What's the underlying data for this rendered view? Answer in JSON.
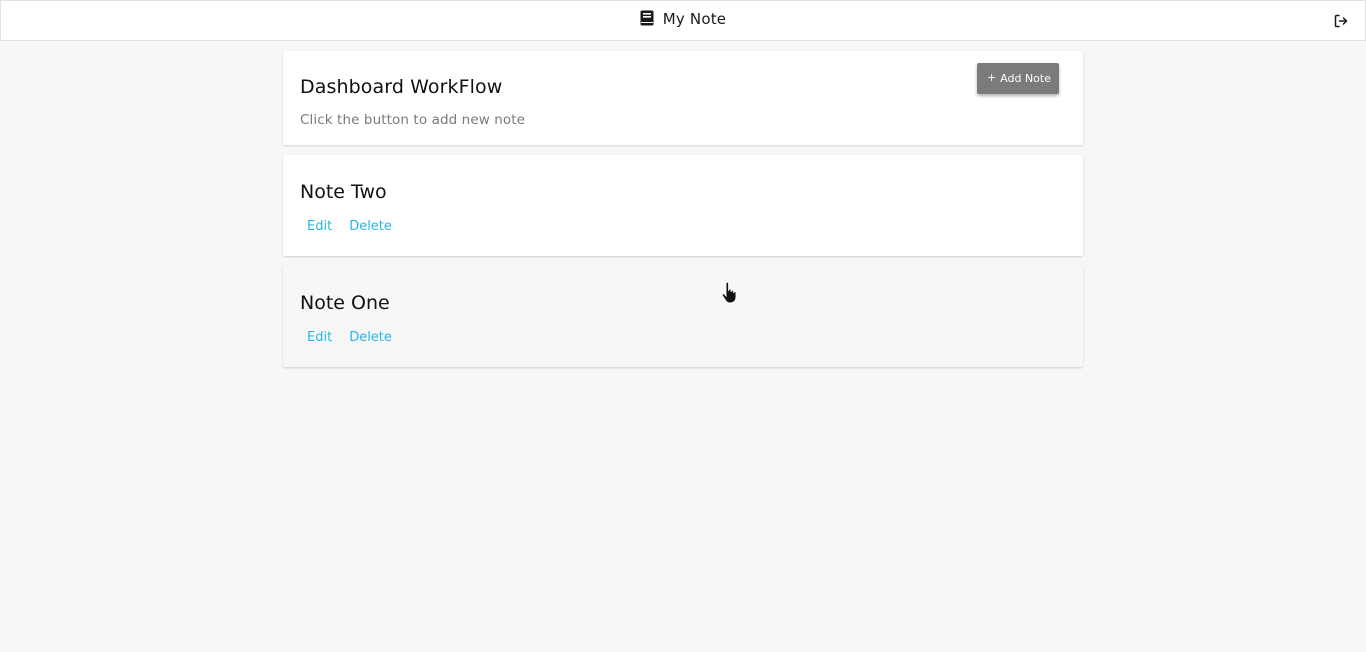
{
  "header": {
    "title": "My Note",
    "brand_icon": "book-icon",
    "logout_icon": "logout-icon"
  },
  "dashboard": {
    "title": "Dashboard WorkFlow",
    "subtitle": "Click the button to add new note",
    "add_button_label": "Add Note",
    "add_button_icon": "plus-icon"
  },
  "notes": [
    {
      "title": "Note Two",
      "edit_label": "Edit",
      "delete_label": "Delete"
    },
    {
      "title": "Note One",
      "edit_label": "Edit",
      "delete_label": "Delete"
    }
  ],
  "colors": {
    "link": "#29b6e8",
    "button_bg": "#7a7b7d",
    "page_bg": "#f7f7f7"
  }
}
